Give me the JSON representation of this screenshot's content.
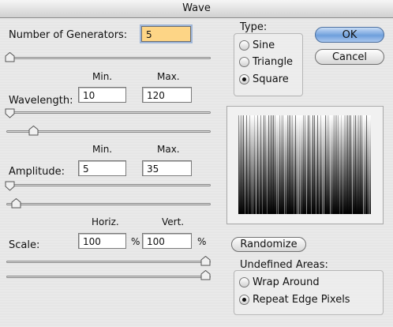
{
  "window": {
    "title": "Wave"
  },
  "generators": {
    "label": "Number of Generators:",
    "value": "5",
    "slider_fraction": 0.0
  },
  "wavelength": {
    "label": "Wavelength:",
    "min_header": "Min.",
    "max_header": "Max.",
    "min": "10",
    "max": "120",
    "min_slider_fraction": 0.0,
    "max_slider_fraction": 0.14
  },
  "amplitude": {
    "label": "Amplitude:",
    "min_header": "Min.",
    "max_header": "Max.",
    "min": "5",
    "max": "35",
    "min_slider_fraction": 0.0,
    "max_slider_fraction": 0.04
  },
  "scale": {
    "label": "Scale:",
    "horiz_header": "Horiz.",
    "vert_header": "Vert.",
    "horiz": "100",
    "vert": "100",
    "unit": "%",
    "horiz_slider_fraction": 1.0,
    "vert_slider_fraction": 1.0
  },
  "type": {
    "label": "Type:",
    "options": [
      "Sine",
      "Triangle",
      "Square"
    ],
    "selected": "Square"
  },
  "buttons": {
    "ok": "OK",
    "cancel": "Cancel",
    "randomize": "Randomize"
  },
  "undefined_areas": {
    "label": "Undefined Areas:",
    "options": [
      "Wrap Around",
      "Repeat Edge Pixels"
    ],
    "selected": "Repeat Edge Pixels"
  },
  "colors": {
    "focus_field": "#fdd586",
    "default_button": "#6f9fdc"
  }
}
